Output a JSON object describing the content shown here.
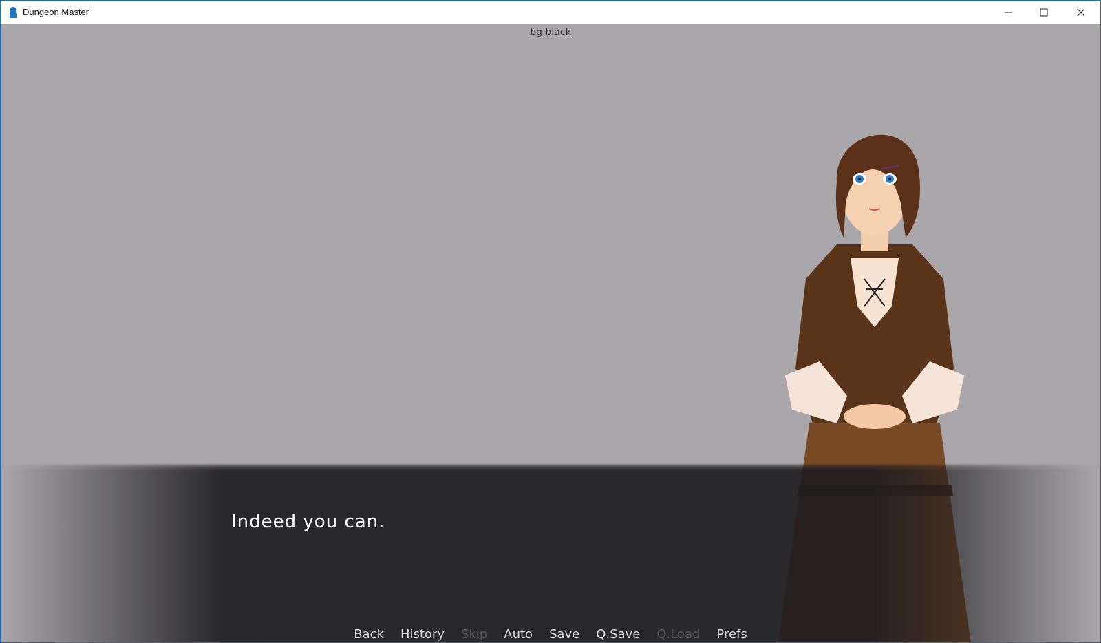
{
  "window": {
    "title": "Dungeon Master",
    "icon": "app-silhouette-icon",
    "controls": [
      "minimize-icon",
      "maximize-icon",
      "close-icon"
    ]
  },
  "scene": {
    "debug_label": "bg black",
    "background_color": "#a9a7aa"
  },
  "dialogue": {
    "text": "Indeed you can."
  },
  "quick_menu": [
    {
      "label": "Back",
      "enabled": true
    },
    {
      "label": "History",
      "enabled": true
    },
    {
      "label": "Skip",
      "enabled": false
    },
    {
      "label": "Auto",
      "enabled": true
    },
    {
      "label": "Save",
      "enabled": true
    },
    {
      "label": "Q.Save",
      "enabled": true
    },
    {
      "label": "Q.Load",
      "enabled": false
    },
    {
      "label": "Prefs",
      "enabled": true
    }
  ]
}
